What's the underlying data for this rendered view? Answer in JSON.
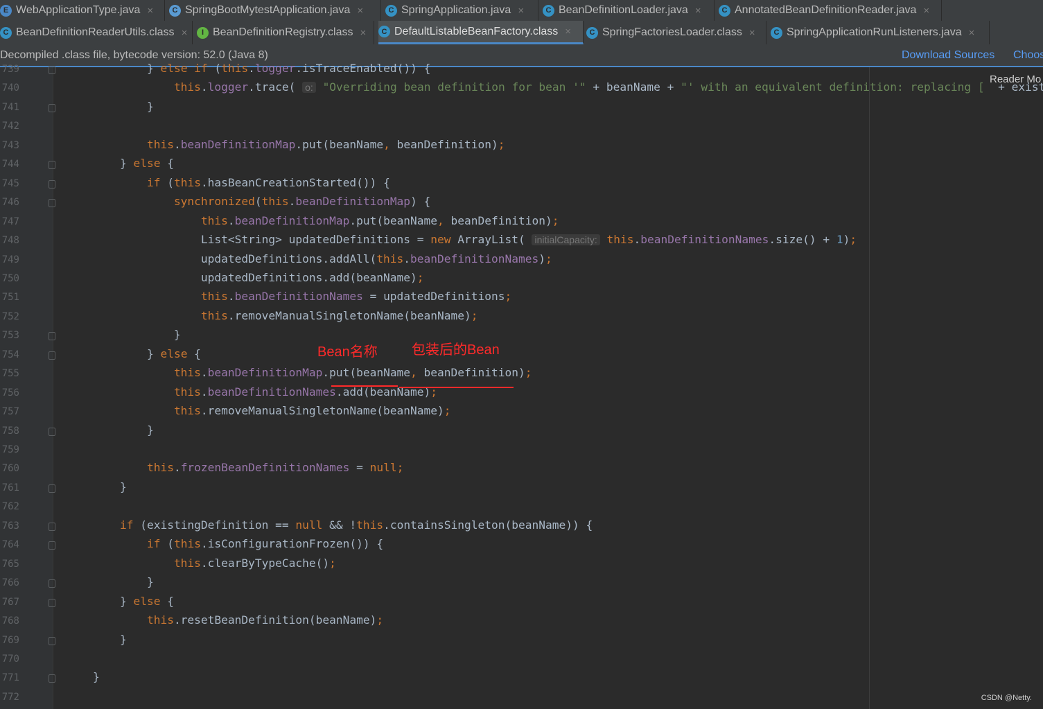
{
  "tabs_row1": [
    {
      "label": "WebApplicationType.java",
      "icon": "enum-icon",
      "color": "#4a88c7",
      "glyph": "E"
    },
    {
      "label": "SpringBootMytestApplication.java",
      "icon": "spring-class-icon",
      "color": "#5a9bd3",
      "glyph": "C"
    },
    {
      "label": "SpringApplication.java",
      "icon": "class-icon",
      "color": "#3592c4",
      "glyph": "C"
    },
    {
      "label": "BeanDefinitionLoader.java",
      "icon": "class-icon",
      "color": "#3592c4",
      "glyph": "C"
    },
    {
      "label": "AnnotatedBeanDefinitionReader.java",
      "icon": "class-icon",
      "color": "#3592c4",
      "glyph": "C"
    }
  ],
  "tabs_row2": [
    {
      "label": "BeanDefinitionReaderUtils.class",
      "icon": "class-icon",
      "color": "#3592c4",
      "glyph": "C"
    },
    {
      "label": "BeanDefinitionRegistry.class",
      "icon": "interface-icon",
      "color": "#62b543",
      "glyph": "I"
    },
    {
      "label": "DefaultListableBeanFactory.class",
      "icon": "class-icon",
      "color": "#3592c4",
      "glyph": "C",
      "active": true
    },
    {
      "label": "SpringFactoriesLoader.class",
      "icon": "class-icon",
      "color": "#3592c4",
      "glyph": "C"
    },
    {
      "label": "SpringApplicationRunListeners.java",
      "icon": "class-icon",
      "color": "#3592c4",
      "glyph": "C"
    }
  ],
  "infobar": {
    "message": "Decompiled .class file, bytecode version: 52.0 (Java 8)",
    "download": "Download Sources",
    "choose": "Choos"
  },
  "reader_mode": "Reader Mo",
  "annotations": {
    "bean_name": "Bean名称",
    "wrapped_bean": "包装后的Bean"
  },
  "watermark": "CSDN @Netty.",
  "code_lines": [
    {
      "n": "739",
      "fold": true,
      "t": [
        [
          "p",
          "            } "
        ],
        [
          "kw",
          "else if"
        ],
        [
          "p",
          " ("
        ],
        [
          "kw",
          "this"
        ],
        [
          "p",
          "."
        ],
        [
          "fld",
          "logger"
        ],
        [
          "p",
          ".isTraceEnabled()) {"
        ]
      ]
    },
    {
      "n": "740",
      "fold": false,
      "t": [
        [
          "p",
          "                "
        ],
        [
          "kw",
          "this"
        ],
        [
          "p",
          "."
        ],
        [
          "fld",
          "logger"
        ],
        [
          "p",
          ".trace( "
        ],
        [
          "hint",
          "o:"
        ],
        [
          "p",
          " "
        ],
        [
          "str",
          "\"Overriding bean definition for bean '\""
        ],
        [
          "p",
          " + beanName + "
        ],
        [
          "str",
          "\"' with an equivalent definition: replacing ["
        ],
        [
          "p",
          "  + existi"
        ]
      ]
    },
    {
      "n": "741",
      "fold": true,
      "t": [
        [
          "p",
          "            }"
        ]
      ]
    },
    {
      "n": "742",
      "fold": false,
      "t": []
    },
    {
      "n": "743",
      "fold": false,
      "t": [
        [
          "p",
          "            "
        ],
        [
          "kw",
          "this"
        ],
        [
          "p",
          "."
        ],
        [
          "fld",
          "beanDefinitionMap"
        ],
        [
          "p",
          ".put(beanName"
        ],
        [
          "kw",
          ","
        ],
        [
          "p",
          " beanDefinition)"
        ],
        [
          "kw",
          ";"
        ]
      ]
    },
    {
      "n": "744",
      "fold": true,
      "t": [
        [
          "p",
          "        } "
        ],
        [
          "kw",
          "else"
        ],
        [
          "p",
          " {"
        ]
      ]
    },
    {
      "n": "745",
      "fold": true,
      "t": [
        [
          "p",
          "            "
        ],
        [
          "kw",
          "if"
        ],
        [
          "p",
          " ("
        ],
        [
          "kw",
          "this"
        ],
        [
          "p",
          ".hasBeanCreationStarted()) {"
        ]
      ]
    },
    {
      "n": "746",
      "fold": true,
      "t": [
        [
          "p",
          "                "
        ],
        [
          "kw",
          "synchronized"
        ],
        [
          "p",
          "("
        ],
        [
          "kw",
          "this"
        ],
        [
          "p",
          "."
        ],
        [
          "fld",
          "beanDefinitionMap"
        ],
        [
          "p",
          ") {"
        ]
      ]
    },
    {
      "n": "747",
      "fold": false,
      "t": [
        [
          "p",
          "                    "
        ],
        [
          "kw",
          "this"
        ],
        [
          "p",
          "."
        ],
        [
          "fld",
          "beanDefinitionMap"
        ],
        [
          "p",
          ".put(beanName"
        ],
        [
          "kw",
          ","
        ],
        [
          "p",
          " beanDefinition)"
        ],
        [
          "kw",
          ";"
        ]
      ]
    },
    {
      "n": "748",
      "fold": false,
      "t": [
        [
          "p",
          "                    List<String> updatedDefinitions = "
        ],
        [
          "kw",
          "new"
        ],
        [
          "p",
          " ArrayList( "
        ],
        [
          "hint",
          "initialCapacity:"
        ],
        [
          "p",
          " "
        ],
        [
          "kw",
          "this"
        ],
        [
          "p",
          "."
        ],
        [
          "fld",
          "beanDefinitionNames"
        ],
        [
          "p",
          ".size() + "
        ],
        [
          "num",
          "1"
        ],
        [
          "p",
          ")"
        ],
        [
          "kw",
          ";"
        ]
      ]
    },
    {
      "n": "749",
      "fold": false,
      "t": [
        [
          "p",
          "                    updatedDefinitions.addAll("
        ],
        [
          "kw",
          "this"
        ],
        [
          "p",
          "."
        ],
        [
          "fld",
          "beanDefinitionNames"
        ],
        [
          "p",
          ")"
        ],
        [
          "kw",
          ";"
        ]
      ]
    },
    {
      "n": "750",
      "fold": false,
      "t": [
        [
          "p",
          "                    updatedDefinitions.add(beanName)"
        ],
        [
          "kw",
          ";"
        ]
      ]
    },
    {
      "n": "751",
      "fold": false,
      "t": [
        [
          "p",
          "                    "
        ],
        [
          "kw",
          "this"
        ],
        [
          "p",
          "."
        ],
        [
          "fld",
          "beanDefinitionNames"
        ],
        [
          "p",
          " = updatedDefinitions"
        ],
        [
          "kw",
          ";"
        ]
      ]
    },
    {
      "n": "752",
      "fold": false,
      "t": [
        [
          "p",
          "                    "
        ],
        [
          "kw",
          "this"
        ],
        [
          "p",
          ".removeManualSingletonName(beanName)"
        ],
        [
          "kw",
          ";"
        ]
      ]
    },
    {
      "n": "753",
      "fold": true,
      "t": [
        [
          "p",
          "                }"
        ]
      ]
    },
    {
      "n": "754",
      "fold": true,
      "t": [
        [
          "p",
          "            } "
        ],
        [
          "kw",
          "else"
        ],
        [
          "p",
          " {"
        ]
      ]
    },
    {
      "n": "755",
      "fold": false,
      "t": [
        [
          "p",
          "                "
        ],
        [
          "kw",
          "this"
        ],
        [
          "p",
          "."
        ],
        [
          "fld",
          "beanDefinitionMap"
        ],
        [
          "p",
          ".put(beanName"
        ],
        [
          "kw",
          ","
        ],
        [
          "p",
          " beanDefinition)"
        ],
        [
          "kw",
          ";"
        ]
      ]
    },
    {
      "n": "756",
      "fold": false,
      "t": [
        [
          "p",
          "                "
        ],
        [
          "kw",
          "this"
        ],
        [
          "p",
          "."
        ],
        [
          "fld",
          "beanDefinitionNames"
        ],
        [
          "p",
          ".add(beanName)"
        ],
        [
          "kw",
          ";"
        ]
      ]
    },
    {
      "n": "757",
      "fold": false,
      "t": [
        [
          "p",
          "                "
        ],
        [
          "kw",
          "this"
        ],
        [
          "p",
          ".removeManualSingletonName(beanName)"
        ],
        [
          "kw",
          ";"
        ]
      ]
    },
    {
      "n": "758",
      "fold": true,
      "t": [
        [
          "p",
          "            }"
        ]
      ]
    },
    {
      "n": "759",
      "fold": false,
      "t": []
    },
    {
      "n": "760",
      "fold": false,
      "t": [
        [
          "p",
          "            "
        ],
        [
          "kw",
          "this"
        ],
        [
          "p",
          "."
        ],
        [
          "fld",
          "frozenBeanDefinitionNames"
        ],
        [
          "p",
          " = "
        ],
        [
          "kw",
          "null;"
        ]
      ]
    },
    {
      "n": "761",
      "fold": true,
      "t": [
        [
          "p",
          "        }"
        ]
      ]
    },
    {
      "n": "762",
      "fold": false,
      "t": []
    },
    {
      "n": "763",
      "fold": true,
      "t": [
        [
          "p",
          "        "
        ],
        [
          "kw",
          "if"
        ],
        [
          "p",
          " (existingDefinition == "
        ],
        [
          "kw",
          "null"
        ],
        [
          "p",
          " && !"
        ],
        [
          "kw",
          "this"
        ],
        [
          "p",
          ".containsSingleton(beanName)) {"
        ]
      ]
    },
    {
      "n": "764",
      "fold": true,
      "t": [
        [
          "p",
          "            "
        ],
        [
          "kw",
          "if"
        ],
        [
          "p",
          " ("
        ],
        [
          "kw",
          "this"
        ],
        [
          "p",
          ".isConfigurationFrozen()) {"
        ]
      ]
    },
    {
      "n": "765",
      "fold": false,
      "t": [
        [
          "p",
          "                "
        ],
        [
          "kw",
          "this"
        ],
        [
          "p",
          ".clearByTypeCache()"
        ],
        [
          "kw",
          ";"
        ]
      ]
    },
    {
      "n": "766",
      "fold": true,
      "t": [
        [
          "p",
          "            }"
        ]
      ]
    },
    {
      "n": "767",
      "fold": true,
      "t": [
        [
          "p",
          "        } "
        ],
        [
          "kw",
          "else"
        ],
        [
          "p",
          " {"
        ]
      ]
    },
    {
      "n": "768",
      "fold": false,
      "t": [
        [
          "p",
          "            "
        ],
        [
          "kw",
          "this"
        ],
        [
          "p",
          ".resetBeanDefinition(beanName)"
        ],
        [
          "kw",
          ";"
        ]
      ]
    },
    {
      "n": "769",
      "fold": true,
      "t": [
        [
          "p",
          "        }"
        ]
      ]
    },
    {
      "n": "770",
      "fold": false,
      "t": []
    },
    {
      "n": "771",
      "fold": true,
      "t": [
        [
          "p",
          "    }"
        ]
      ]
    },
    {
      "n": "772",
      "fold": false,
      "t": []
    }
  ]
}
